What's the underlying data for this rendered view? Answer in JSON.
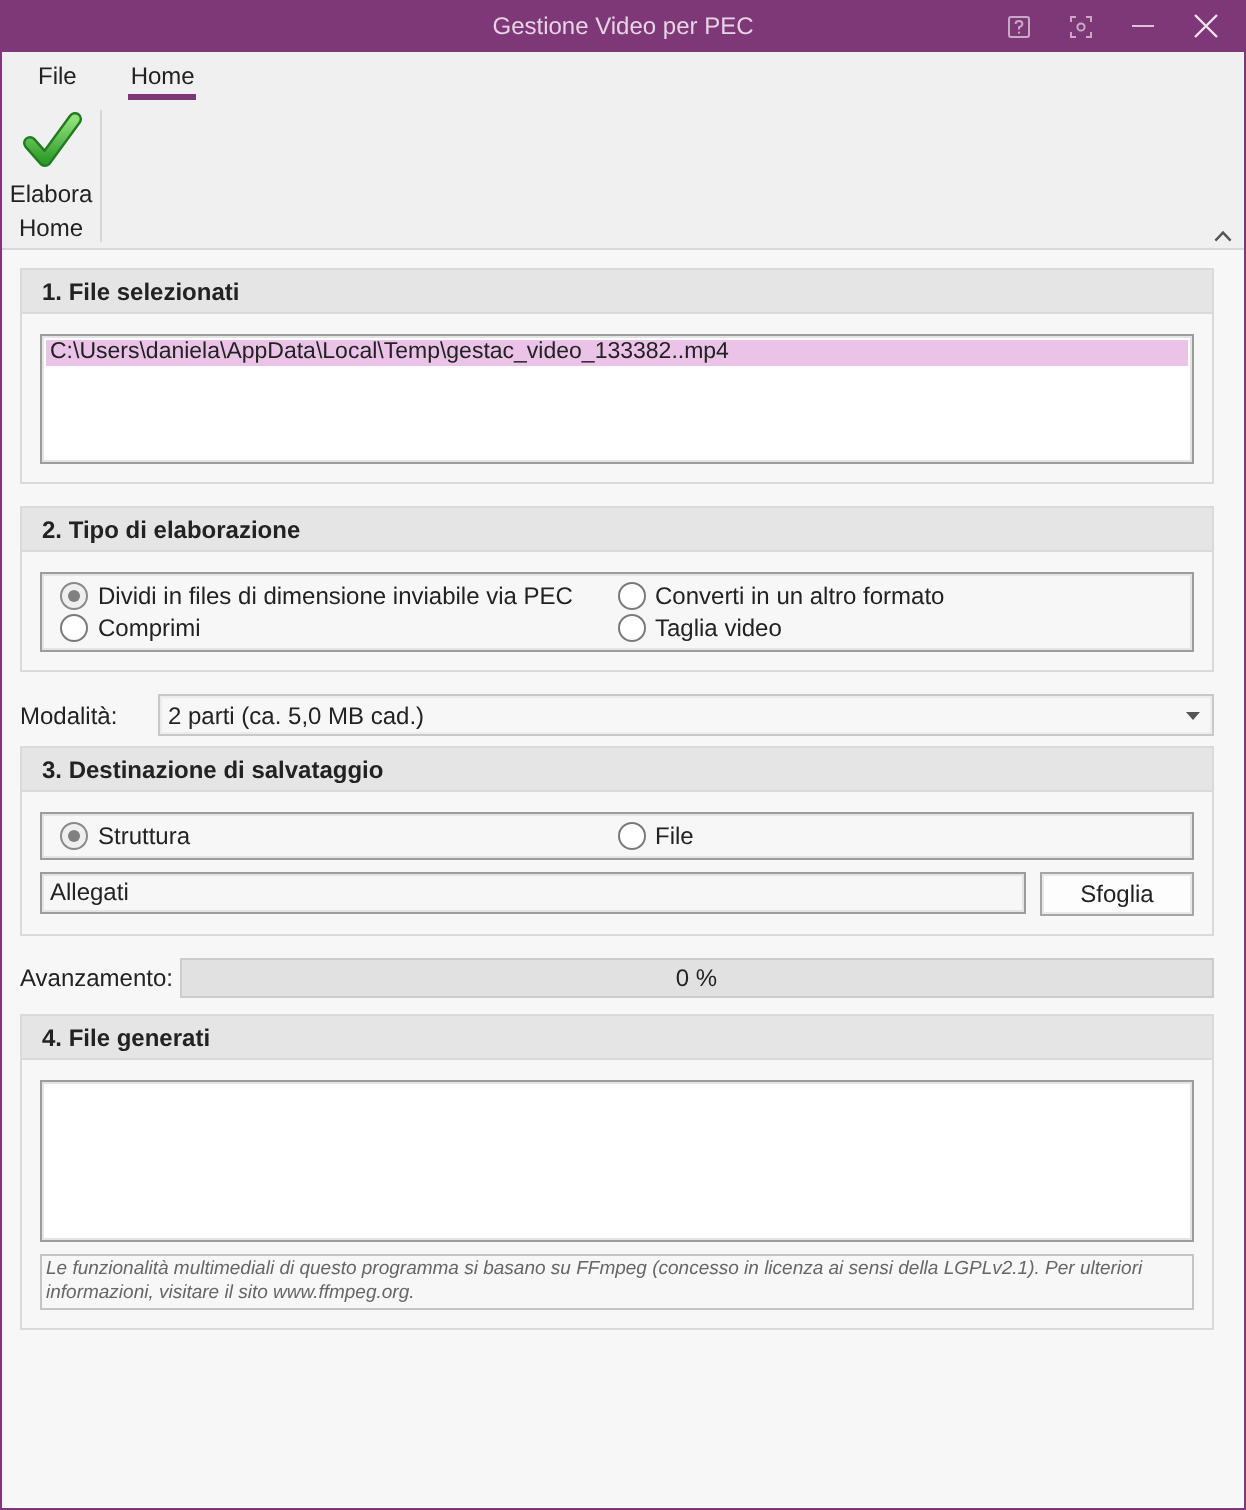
{
  "window": {
    "title": "Gestione Video per PEC"
  },
  "ribbon": {
    "tabs": [
      {
        "label": "File",
        "selected": false
      },
      {
        "label": "Home",
        "selected": true
      }
    ],
    "buttons": [
      {
        "label": "Elabora"
      }
    ],
    "group_label": "Home"
  },
  "file_selection": {
    "title": "1. File selezionati",
    "files": [
      {
        "path": "C:\\Users\\daniela\\AppData\\Local\\Temp\\gestac_video_133382..mp4",
        "selected": true
      }
    ]
  },
  "processing_type": {
    "title": "2. Tipo di elaborazione",
    "options": [
      {
        "label": "Dividi in files di dimensione inviabile via PEC",
        "selected": true
      },
      {
        "label": "Converti in un altro formato",
        "selected": false
      },
      {
        "label": "Comprimi",
        "selected": false
      },
      {
        "label": "Taglia video",
        "selected": false
      }
    ]
  },
  "mode": {
    "label": "Modalità:",
    "value": "2 parti (ca. 5,0 MB cad.)"
  },
  "destination": {
    "title": "3. Destinazione di salvataggio",
    "options": [
      {
        "label": "Struttura",
        "selected": true
      },
      {
        "label": "File",
        "selected": false
      }
    ],
    "folder": {
      "value": "Allegati"
    },
    "browse_button": "Sfoglia"
  },
  "progress": {
    "label": "Avanzamento:",
    "level": 0,
    "reading": "0 %"
  },
  "generated_files": {
    "title": "4. File generati",
    "notice": "Le funzionalità multimediali di questo programma si basano su FFmpeg (concesso in licenza ai sensi della LGPLv2.1). Per ulteriori informazioni, visitare il sito www.ffmpeg.org."
  }
}
